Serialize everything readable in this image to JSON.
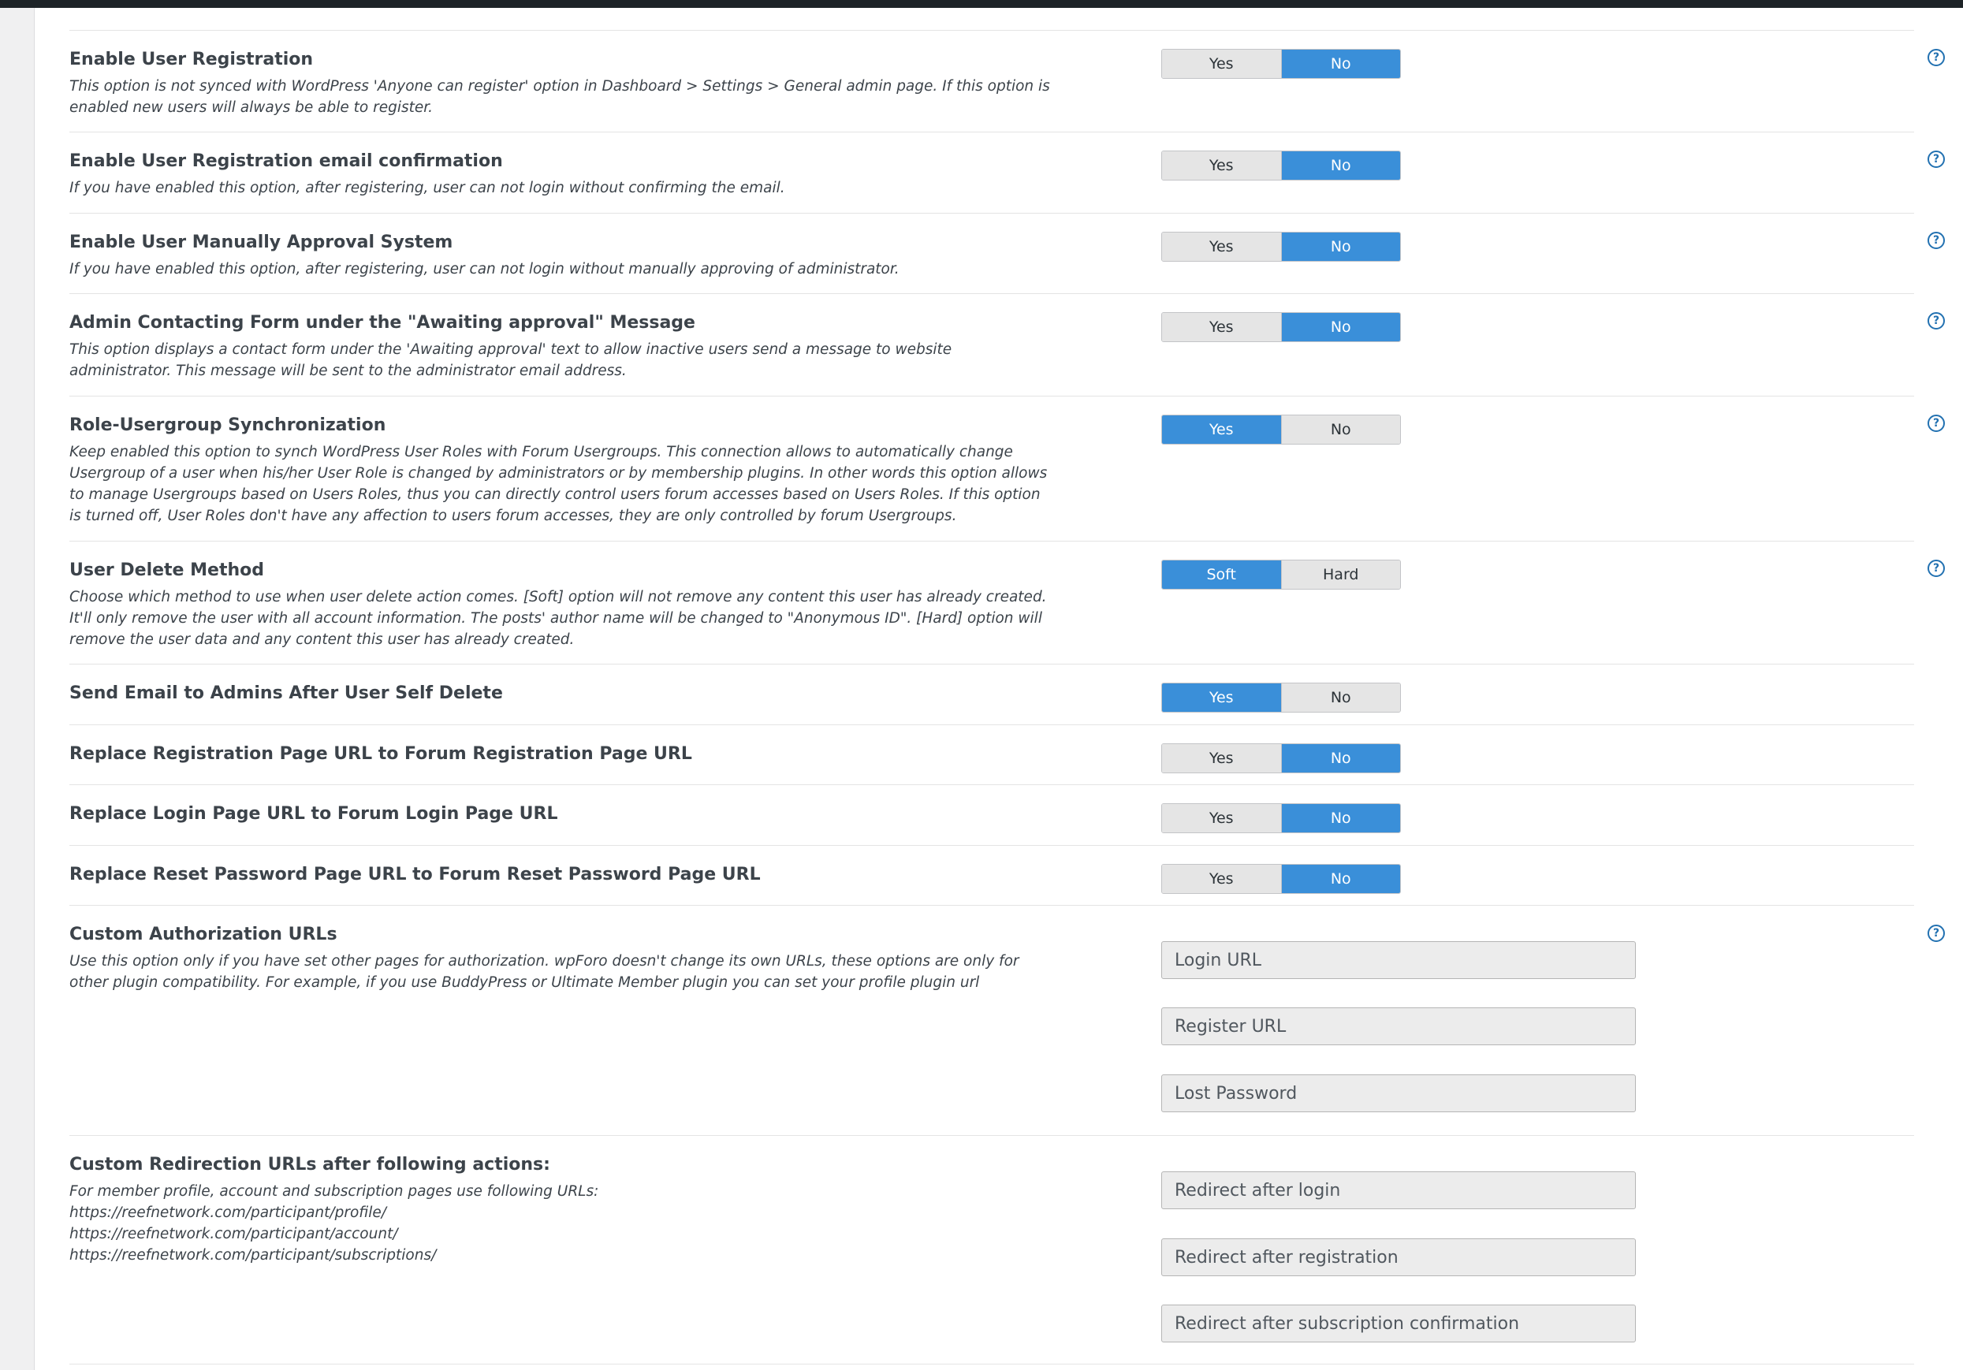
{
  "settings": [
    {
      "title": "Enable User Registration",
      "description": "This option is not synced with WordPress 'Anyone can register' option in Dashboard > Settings > General admin page. If this option is enabled new users will always be able to register.",
      "options": [
        "Yes",
        "No"
      ],
      "selected": "No",
      "help": true
    },
    {
      "title": "Enable User Registration email confirmation",
      "description": "If you have enabled this option, after registering, user can not login without confirming the email.",
      "options": [
        "Yes",
        "No"
      ],
      "selected": "No",
      "help": true
    },
    {
      "title": "Enable User Manually Approval System",
      "description": "If you have enabled this option, after registering, user can not login without manually approving of administrator.",
      "options": [
        "Yes",
        "No"
      ],
      "selected": "No",
      "help": true
    },
    {
      "title": "Admin Contacting Form under the \"Awaiting approval\" Message",
      "description": "This option displays a contact form under the 'Awaiting approval' text to allow inactive users send a message to website administrator. This message will be sent to the administrator email address.",
      "options": [
        "Yes",
        "No"
      ],
      "selected": "No",
      "help": true
    },
    {
      "title": "Role-Usergroup Synchronization",
      "description": "Keep enabled this option to synch WordPress User Roles with Forum Usergroups. This connection allows to automatically change Usergroup of a user when his/her User Role is changed by administrators or by membership plugins. In other words this option allows to manage Usergroups based on Users Roles, thus you can directly control users forum accesses based on Users Roles. If this option is turned off, User Roles don't have any affection to users forum accesses, they are only controlled by forum Usergroups.",
      "options": [
        "Yes",
        "No"
      ],
      "selected": "Yes",
      "help": true
    },
    {
      "title": "User Delete Method",
      "description": "Choose which method to use when user delete action comes. [Soft] option will not remove any content this user has already created. It'll only remove the user with all account information. The posts' author name will be changed to \"Anonymous ID\". [Hard] option will remove the user data and any content this user has already created.",
      "options": [
        "Soft",
        "Hard"
      ],
      "selected": "Soft",
      "help": true
    },
    {
      "title": "Send Email to Admins After User Self Delete",
      "description": "",
      "options": [
        "Yes",
        "No"
      ],
      "selected": "Yes",
      "help": false
    },
    {
      "title": "Replace Registration Page URL to Forum Registration Page URL",
      "description": "",
      "options": [
        "Yes",
        "No"
      ],
      "selected": "No",
      "help": false
    },
    {
      "title": "Replace Login Page URL to Forum Login Page URL",
      "description": "",
      "options": [
        "Yes",
        "No"
      ],
      "selected": "No",
      "help": false
    },
    {
      "title": "Replace Reset Password Page URL to Forum Reset Password Page URL",
      "description": "",
      "options": [
        "Yes",
        "No"
      ],
      "selected": "No",
      "help": false
    }
  ],
  "auth_urls": {
    "title": "Custom Authorization URLs",
    "description": "Use this option only if you have set other pages for authorization. wpForo doesn't change its own URLs, these options are only for other plugin compatibility. For example, if you use BuddyPress or Ultimate Member plugin you can set your profile plugin url",
    "fields": [
      {
        "placeholder": "Login URL",
        "value": ""
      },
      {
        "placeholder": "Register URL",
        "value": ""
      },
      {
        "placeholder": "Lost Password",
        "value": ""
      }
    ]
  },
  "redirect_urls": {
    "title": "Custom Redirection URLs after following actions:",
    "description_lines": [
      "For member profile, account and subscription pages use following URLs:",
      "https://reefnetwork.com/participant/profile/",
      "https://reefnetwork.com/participant/account/",
      "https://reefnetwork.com/participant/subscriptions/"
    ],
    "fields": [
      {
        "placeholder": "Redirect after login",
        "value": ""
      },
      {
        "placeholder": "Redirect after registration",
        "value": ""
      },
      {
        "placeholder": "Redirect after subscription confirmation",
        "value": ""
      }
    ]
  },
  "icons": {
    "help": "question-circle-icon"
  },
  "colors": {
    "active": "#3a8fd9",
    "inactive": "#e5e5e5",
    "help": "#2271b1"
  }
}
